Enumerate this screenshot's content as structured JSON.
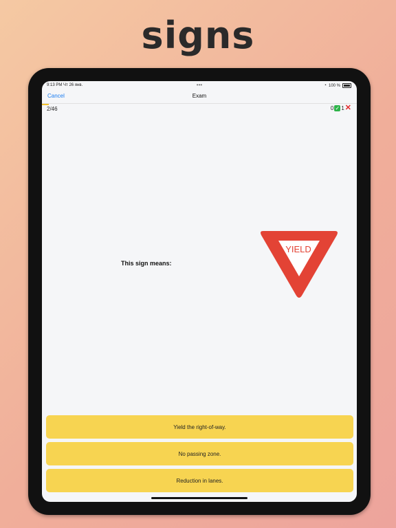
{
  "hero": {
    "title": "signs"
  },
  "status": {
    "time": "9:13 PM",
    "date": "Чт 26 янв.",
    "dots": "•••",
    "battery": "100 %"
  },
  "nav": {
    "cancel": "Cancel",
    "title": "Exam"
  },
  "quiz": {
    "counter": "2/46",
    "correct_count": "0",
    "wrong_count": "1",
    "progress_fraction": 0.043,
    "question": "This sign means:",
    "sign_text": "YIELD",
    "answers": [
      "Yield the right-of-way.",
      "No passing zone.",
      "Reduction in lanes."
    ]
  },
  "colors": {
    "accent_blue": "#1a7cf0",
    "answer_yellow": "#f7d451",
    "sign_red": "#e34335",
    "correct_green": "#2eb34a",
    "wrong_red": "#e3282b"
  }
}
